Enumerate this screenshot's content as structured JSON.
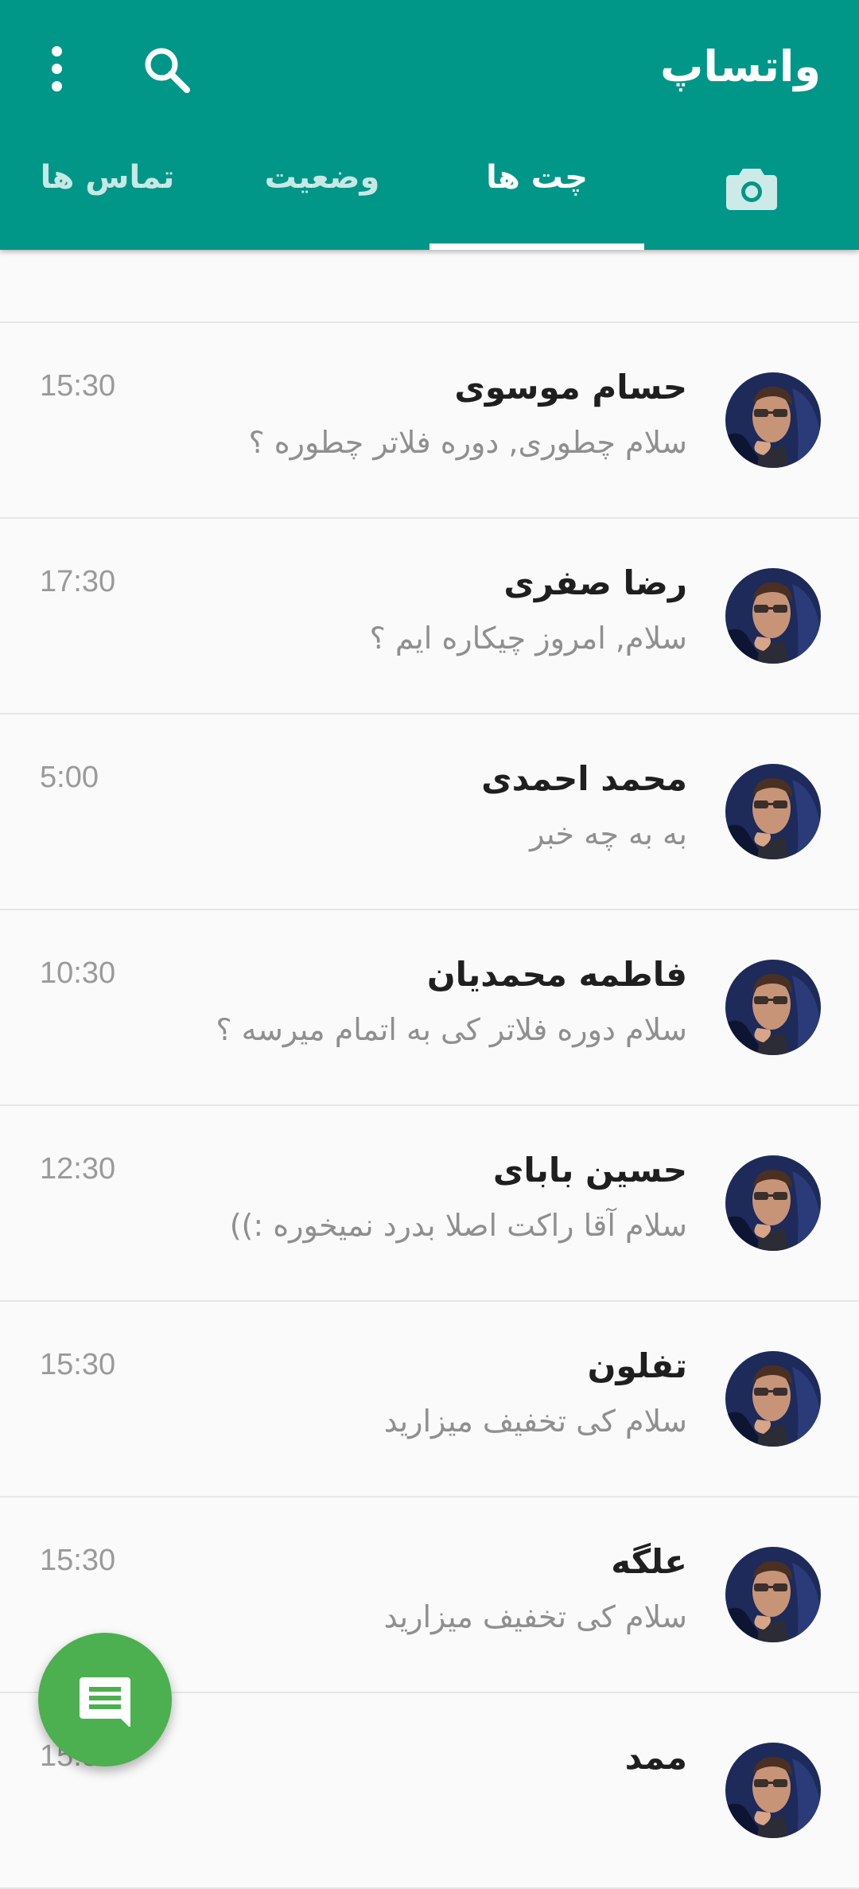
{
  "appbar": {
    "title": "واتساپ",
    "search_icon": "search-icon",
    "menu_icon": "more-vertical-icon",
    "color": "#009688"
  },
  "tabs": [
    {
      "label": "",
      "icon": "camera-icon"
    },
    {
      "label": "چت ها",
      "active": true
    },
    {
      "label": "وضعیت"
    },
    {
      "label": "تماس ها"
    }
  ],
  "chats": [
    {
      "name": "حسام موسوی",
      "message": "سلام چطوری, دوره فلاتر چطوره ؟",
      "time": "15:30"
    },
    {
      "name": "رضا صفری",
      "message": "سلام, امروز چیکاره ایم ؟",
      "time": "17:30"
    },
    {
      "name": "محمد احمدی",
      "message": "به به چه خبر",
      "time": "5:00"
    },
    {
      "name": "فاطمه محمدیان",
      "message": "سلام دوره فلاتر کی به اتمام میرسه ؟",
      "time": "10:30"
    },
    {
      "name": "حسین بابای",
      "message": "سلام آقا راکت اصلا بدرد نمیخوره :))",
      "time": "12:30"
    },
    {
      "name": "تفلون",
      "message": "سلام کی تخفیف میزارید",
      "time": "15:30"
    },
    {
      "name": "علگه",
      "message": "سلام کی تخفیف میزارید",
      "time": "15:30"
    },
    {
      "name": "ممد",
      "message": "",
      "time": "15:30"
    }
  ],
  "fab": {
    "icon": "new-chat-icon",
    "color": "#4caf50"
  }
}
